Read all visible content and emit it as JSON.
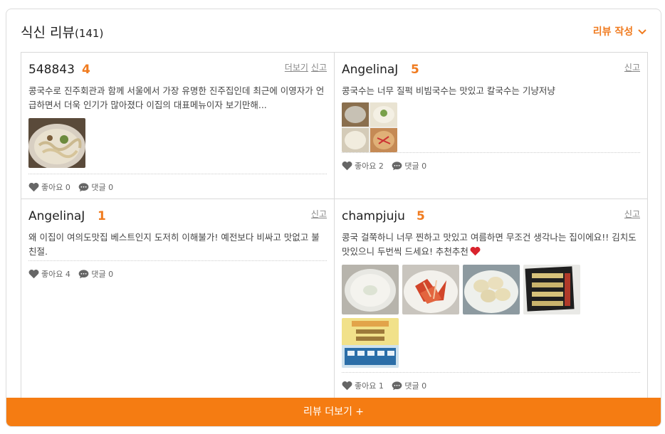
{
  "header": {
    "title": "식신 리뷰",
    "count": "(141)",
    "write_label": "리뷰 작성"
  },
  "reviews": [
    {
      "user": "548843",
      "score": "4",
      "more_label": "더보기",
      "report_label": "신고",
      "text": "콩국수로 진주회관과 함께 서울에서 가장 유명한 진주집인데 최근에 이영자가 언급하면서 더욱 인기가 많아졌다 이집의 대표메뉴이자 보기만해...",
      "likes_label": "좋아요",
      "likes": "0",
      "comments_label": "댓글",
      "comments": "0"
    },
    {
      "user": "AngelinaJ",
      "score": "5",
      "report_label": "신고",
      "text": "콩국수는 너무 질퍽 비빔국수는 맛있고 칼국수는 기냥저냥",
      "likes_label": "좋아요",
      "likes": "2",
      "comments_label": "댓글",
      "comments": "0"
    },
    {
      "user": "AngelinaJ",
      "score": "1",
      "report_label": "신고",
      "text": "왜 이집이 여의도맛집 베스트인지 도저히 이해불가! 예전보다 비싸고 맛없고 불친절.",
      "likes_label": "좋아요",
      "likes": "4",
      "comments_label": "댓글",
      "comments": "0"
    },
    {
      "user": "champjuju",
      "score": "5",
      "report_label": "신고",
      "text": "콩국 걸쭉하니 너무 찐하고 맛있고 여름하면 무조건 생각나는 집이에요!! 김치도 맛있으니 두번씩 드세요! 추천추천",
      "likes_label": "좋아요",
      "likes": "1",
      "comments_label": "댓글",
      "comments": "0"
    }
  ],
  "footer": {
    "more_reviews_label": "리뷰 더보기 +"
  },
  "colors": {
    "accent": "#f57c12",
    "score": "#f07b1f"
  },
  "icons": [
    "chevron-down-icon",
    "heart-icon",
    "comment-icon"
  ]
}
